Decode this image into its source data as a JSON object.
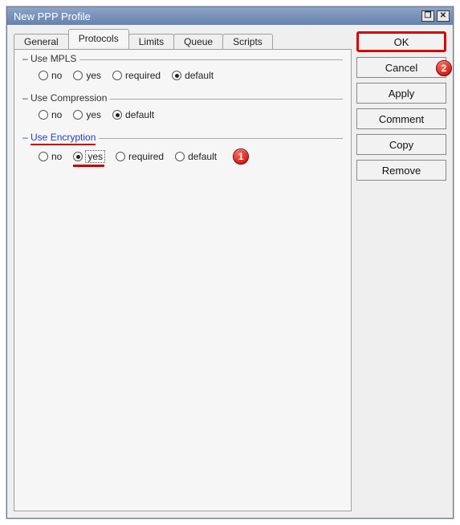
{
  "window": {
    "title": "New PPP Profile"
  },
  "tabs": {
    "general": "General",
    "protocols": "Protocols",
    "limits": "Limits",
    "queue": "Queue",
    "scripts": "Scripts",
    "active": "protocols"
  },
  "buttons": {
    "ok": "OK",
    "cancel": "Cancel",
    "apply": "Apply",
    "comment": "Comment",
    "copy": "Copy",
    "remove": "Remove"
  },
  "groups": {
    "mpls": {
      "legend": "Use MPLS",
      "options": {
        "no": "no",
        "yes": "yes",
        "required": "required",
        "default": "default"
      },
      "selected": "default"
    },
    "compression": {
      "legend": "Use Compression",
      "options": {
        "no": "no",
        "yes": "yes",
        "default": "default"
      },
      "selected": "default"
    },
    "encryption": {
      "legend": "Use Encryption",
      "options": {
        "no": "no",
        "yes": "yes",
        "required": "required",
        "default": "default"
      },
      "selected": "yes"
    }
  },
  "callouts": {
    "one": "1",
    "two": "2"
  }
}
